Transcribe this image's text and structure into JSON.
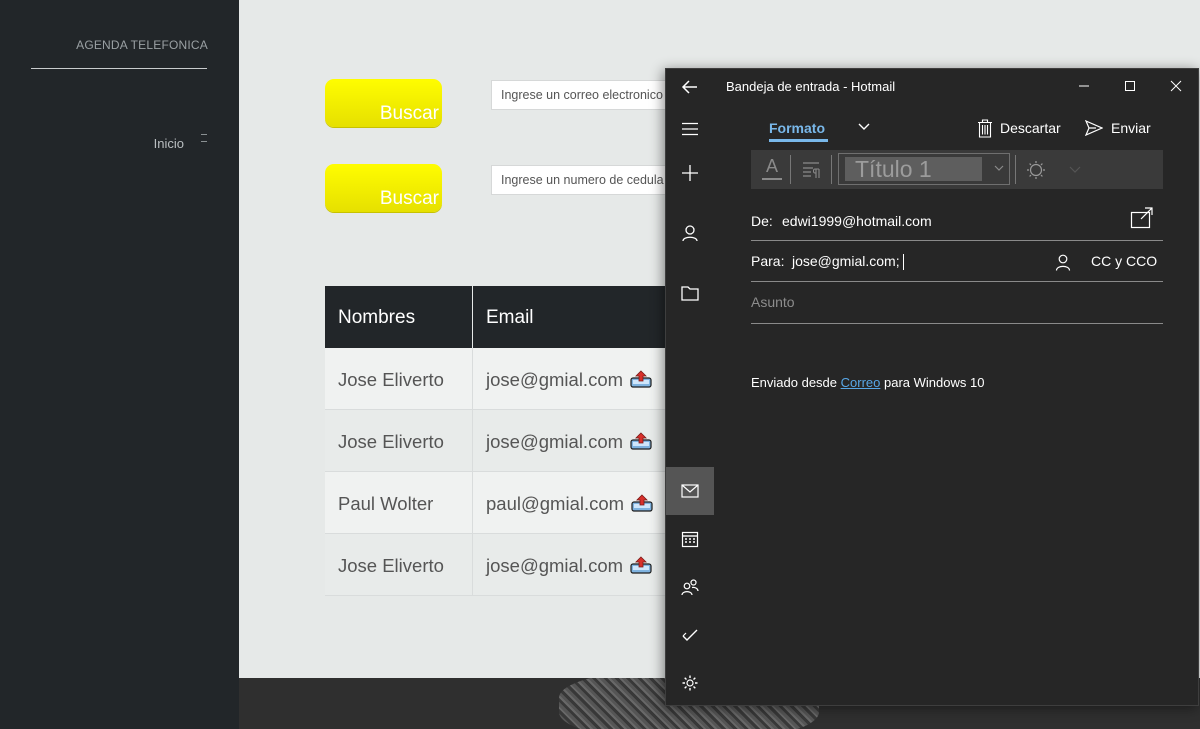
{
  "site": {
    "brand": "AGENDA TELEFONICA",
    "nav": [
      {
        "label": "Inicio"
      }
    ]
  },
  "search": {
    "email": {
      "button": "Buscar",
      "placeholder": "Ingrese un correo electronico"
    },
    "cedula": {
      "button": "Buscar",
      "placeholder": "Ingrese un numero de cedula"
    }
  },
  "table": {
    "headers": [
      "Nombres",
      "Email"
    ],
    "rows": [
      {
        "name": "Jose Eliverto",
        "email": "jose@gmial.com"
      },
      {
        "name": "Jose Eliverto",
        "email": "jose@gmial.com"
      },
      {
        "name": "Paul Wolter",
        "email": "paul@gmial.com"
      },
      {
        "name": "Jose Eliverto",
        "email": "jose@gmial.com"
      }
    ]
  },
  "mail": {
    "title": "Bandeja de entrada - Hotmail",
    "format_tab": "Formato",
    "discard": "Descartar",
    "send": "Enviar",
    "font_glyph": "A",
    "style_value": "Título 1",
    "from_label": "De:",
    "from_value": "edwi1999@hotmail.com",
    "to_label": "Para:",
    "to_value": "jose@gmial.com;",
    "cc_label": "CC y CCO",
    "subject_placeholder": "Asunto",
    "signature_prefix": "Enviado desde ",
    "signature_link": "Correo",
    "signature_suffix": " para Windows 10"
  },
  "colors": {
    "sidebar_bg": "#222629",
    "content_bg": "#e6e9e8",
    "button_yellow": "#fffd00",
    "mail_bg": "#262626",
    "accent_blue": "#79b8ea"
  }
}
